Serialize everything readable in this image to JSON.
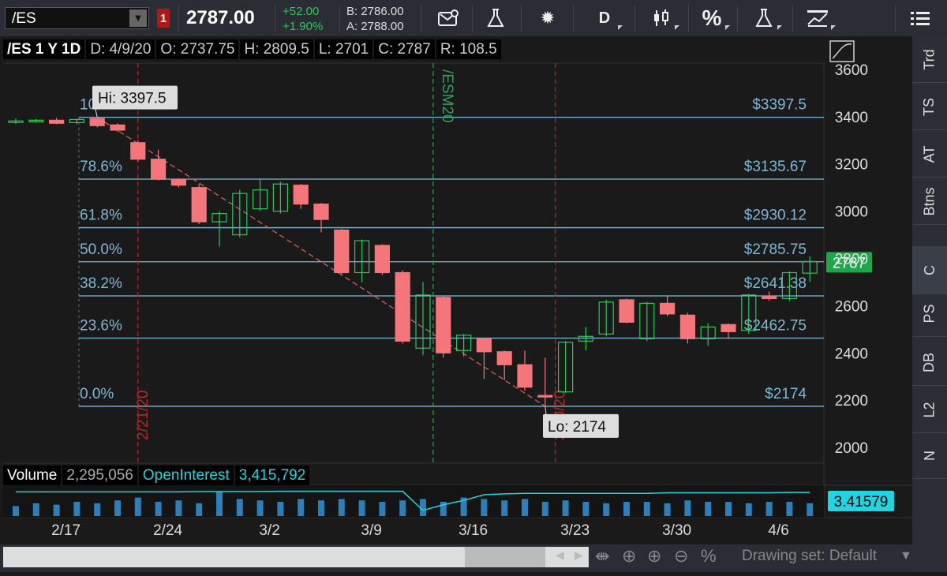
{
  "toolbar": {
    "symbol": "/ES",
    "link_badge": "1",
    "last_price": "2787.00",
    "change": "+52.00",
    "change_pct": "+1.90%",
    "bid": "B: 2786.00",
    "ask": "A: 2788.00",
    "period_label": "D",
    "percent_label": "%"
  },
  "infobar": {
    "symbol_period": "/ES 1 Y 1D",
    "date": "D: 4/9/20",
    "open": "O: 2737.75",
    "high": "H: 2809.5",
    "low": "L: 2701",
    "close": "C: 2787",
    "range": "R: 108.5"
  },
  "volume_bar": {
    "label": "Volume",
    "volume": "2,295,056",
    "oi_label": "OpenInterest",
    "oi_value": "3,415,792",
    "oi_tag": "3.41579"
  },
  "right_tabs": [
    "Trd",
    "TS",
    "AT",
    "Btns",
    "C",
    "PS",
    "DB",
    "L2",
    "N"
  ],
  "bottom": {
    "drawing_set": "Drawing set: Default"
  },
  "colors": {
    "up": "#2ec65b",
    "down": "#f4767a",
    "fib": "#7fb7d6",
    "oi": "#22d4e0",
    "vol": "#2e7fb8"
  },
  "chart_data": {
    "type": "candlestick",
    "ylim": [
      1950,
      3620
    ],
    "y_ticks": [
      2000,
      2200,
      2400,
      2600,
      2800,
      3000,
      3200,
      3400,
      3600
    ],
    "x_labels": [
      {
        "label": "2/17",
        "index": 2
      },
      {
        "label": "2/24",
        "index": 7
      },
      {
        "label": "3/2",
        "index": 12
      },
      {
        "label": "3/9",
        "index": 17
      },
      {
        "label": "3/16",
        "index": 22
      },
      {
        "label": "3/23",
        "index": 27
      },
      {
        "label": "3/30",
        "index": 32
      },
      {
        "label": "4/6",
        "index": 37
      }
    ],
    "candles": [
      {
        "o": 3380,
        "h": 3392,
        "l": 3370,
        "c": 3382
      },
      {
        "o": 3382,
        "h": 3390,
        "l": 3375,
        "c": 3385
      },
      {
        "o": 3385,
        "h": 3395,
        "l": 3368,
        "c": 3372
      },
      {
        "o": 3375,
        "h": 3392,
        "l": 3368,
        "c": 3388
      },
      {
        "o": 3392,
        "h": 3397.5,
        "l": 3355,
        "c": 3362
      },
      {
        "o": 3365,
        "h": 3372,
        "l": 3335,
        "c": 3343
      },
      {
        "o": 3290,
        "h": 3300,
        "l": 3210,
        "c": 3220
      },
      {
        "o": 3220,
        "h": 3260,
        "l": 3130,
        "c": 3135
      },
      {
        "o": 3135,
        "h": 3140,
        "l": 3100,
        "c": 3110
      },
      {
        "o": 3100,
        "h": 3115,
        "l": 2945,
        "c": 2955
      },
      {
        "o": 2955,
        "h": 3000,
        "l": 2850,
        "c": 2990
      },
      {
        "o": 2900,
        "h": 3090,
        "l": 2890,
        "c": 3075
      },
      {
        "o": 3010,
        "h": 3135,
        "l": 3000,
        "c": 3090
      },
      {
        "o": 3000,
        "h": 3125,
        "l": 2990,
        "c": 3115
      },
      {
        "o": 3110,
        "h": 3115,
        "l": 3010,
        "c": 3030
      },
      {
        "o": 3030,
        "h": 3035,
        "l": 2910,
        "c": 2965
      },
      {
        "o": 2920,
        "h": 2925,
        "l": 2730,
        "c": 2740
      },
      {
        "o": 2740,
        "h": 2880,
        "l": 2700,
        "c": 2875
      },
      {
        "o": 2855,
        "h": 2860,
        "l": 2730,
        "c": 2740
      },
      {
        "o": 2740,
        "h": 2750,
        "l": 2440,
        "c": 2450
      },
      {
        "o": 2420,
        "h": 2700,
        "l": 2390,
        "c": 2645
      },
      {
        "o": 2635,
        "h": 2640,
        "l": 2380,
        "c": 2400
      },
      {
        "o": 2410,
        "h": 2480,
        "l": 2385,
        "c": 2475
      },
      {
        "o": 2460,
        "h": 2465,
        "l": 2290,
        "c": 2405
      },
      {
        "o": 2405,
        "h": 2410,
        "l": 2285,
        "c": 2350
      },
      {
        "o": 2350,
        "h": 2410,
        "l": 2240,
        "c": 2255
      },
      {
        "o": 2220,
        "h": 2380,
        "l": 2174,
        "c": 2218
      },
      {
        "o": 2235,
        "h": 2450,
        "l": 2230,
        "c": 2445
      },
      {
        "o": 2450,
        "h": 2510,
        "l": 2410,
        "c": 2470
      },
      {
        "o": 2480,
        "h": 2625,
        "l": 2470,
        "c": 2615
      },
      {
        "o": 2625,
        "h": 2630,
        "l": 2525,
        "c": 2530
      },
      {
        "o": 2460,
        "h": 2615,
        "l": 2450,
        "c": 2610
      },
      {
        "o": 2610,
        "h": 2640,
        "l": 2555,
        "c": 2565
      },
      {
        "o": 2560,
        "h": 2570,
        "l": 2440,
        "c": 2460
      },
      {
        "o": 2460,
        "h": 2525,
        "l": 2430,
        "c": 2510
      },
      {
        "o": 2520,
        "h": 2525,
        "l": 2460,
        "c": 2490
      },
      {
        "o": 2495,
        "h": 2650,
        "l": 2480,
        "c": 2645
      },
      {
        "o": 2640,
        "h": 2660,
        "l": 2620,
        "c": 2630
      },
      {
        "o": 2630,
        "h": 2745,
        "l": 2620,
        "c": 2740
      },
      {
        "o": 2737.75,
        "h": 2809.5,
        "l": 2701,
        "c": 2787
      }
    ],
    "fib_levels": [
      {
        "pct": "100.0%",
        "price_label": "$3397.5",
        "value": 3397.5
      },
      {
        "pct": "78.6%",
        "price_label": "$3135.67",
        "value": 3135.67
      },
      {
        "pct": "61.8%",
        "price_label": "$2930.12",
        "value": 2930.12
      },
      {
        "pct": "50.0%",
        "price_label": "$2785.75",
        "value": 2785.75
      },
      {
        "pct": "38.2%",
        "price_label": "$2641.38",
        "value": 2641.38
      },
      {
        "pct": "23.6%",
        "price_label": "$2462.75",
        "value": 2462.75
      },
      {
        "pct": "0.0%",
        "price_label": "$2174",
        "value": 2174
      }
    ],
    "hi_label": "Hi: 3397.5",
    "lo_label": "Lo: 2174",
    "current_price_tag": "2787",
    "vertical_markers": [
      {
        "label": "2/21/20",
        "index": 6,
        "color": "#b02a2a"
      },
      {
        "label": "/ESM20",
        "index": 20.5,
        "color": "#2fa05a"
      },
      {
        "label": "3/20/20",
        "index": 26.5,
        "color": "#b02a2a"
      }
    ],
    "volume": [
      0.35,
      0.45,
      0.4,
      0.5,
      0.45,
      0.55,
      0.65,
      0.5,
      0.55,
      0.45,
      0.85,
      0.6,
      0.55,
      0.5,
      0.6,
      0.55,
      0.6,
      0.55,
      0.5,
      0.55,
      0.6,
      0.5,
      0.65,
      0.6,
      0.55,
      0.6,
      0.5,
      0.55,
      0.5,
      0.45,
      0.5,
      0.5,
      0.45,
      0.55,
      0.5,
      0.5,
      0.45,
      0.5,
      0.5,
      0.45
    ],
    "open_interest": [
      0.85,
      0.85,
      0.85,
      0.85,
      0.85,
      0.85,
      0.85,
      0.85,
      0.85,
      0.86,
      0.86,
      0.86,
      0.86,
      0.87,
      0.87,
      0.87,
      0.87,
      0.87,
      0.87,
      0.87,
      0.2,
      0.4,
      0.55,
      0.75,
      0.78,
      0.8,
      0.8,
      0.8,
      0.8,
      0.8,
      0.8,
      0.8,
      0.82,
      0.82,
      0.82,
      0.82,
      0.82,
      0.82,
      0.83,
      0.83
    ]
  }
}
